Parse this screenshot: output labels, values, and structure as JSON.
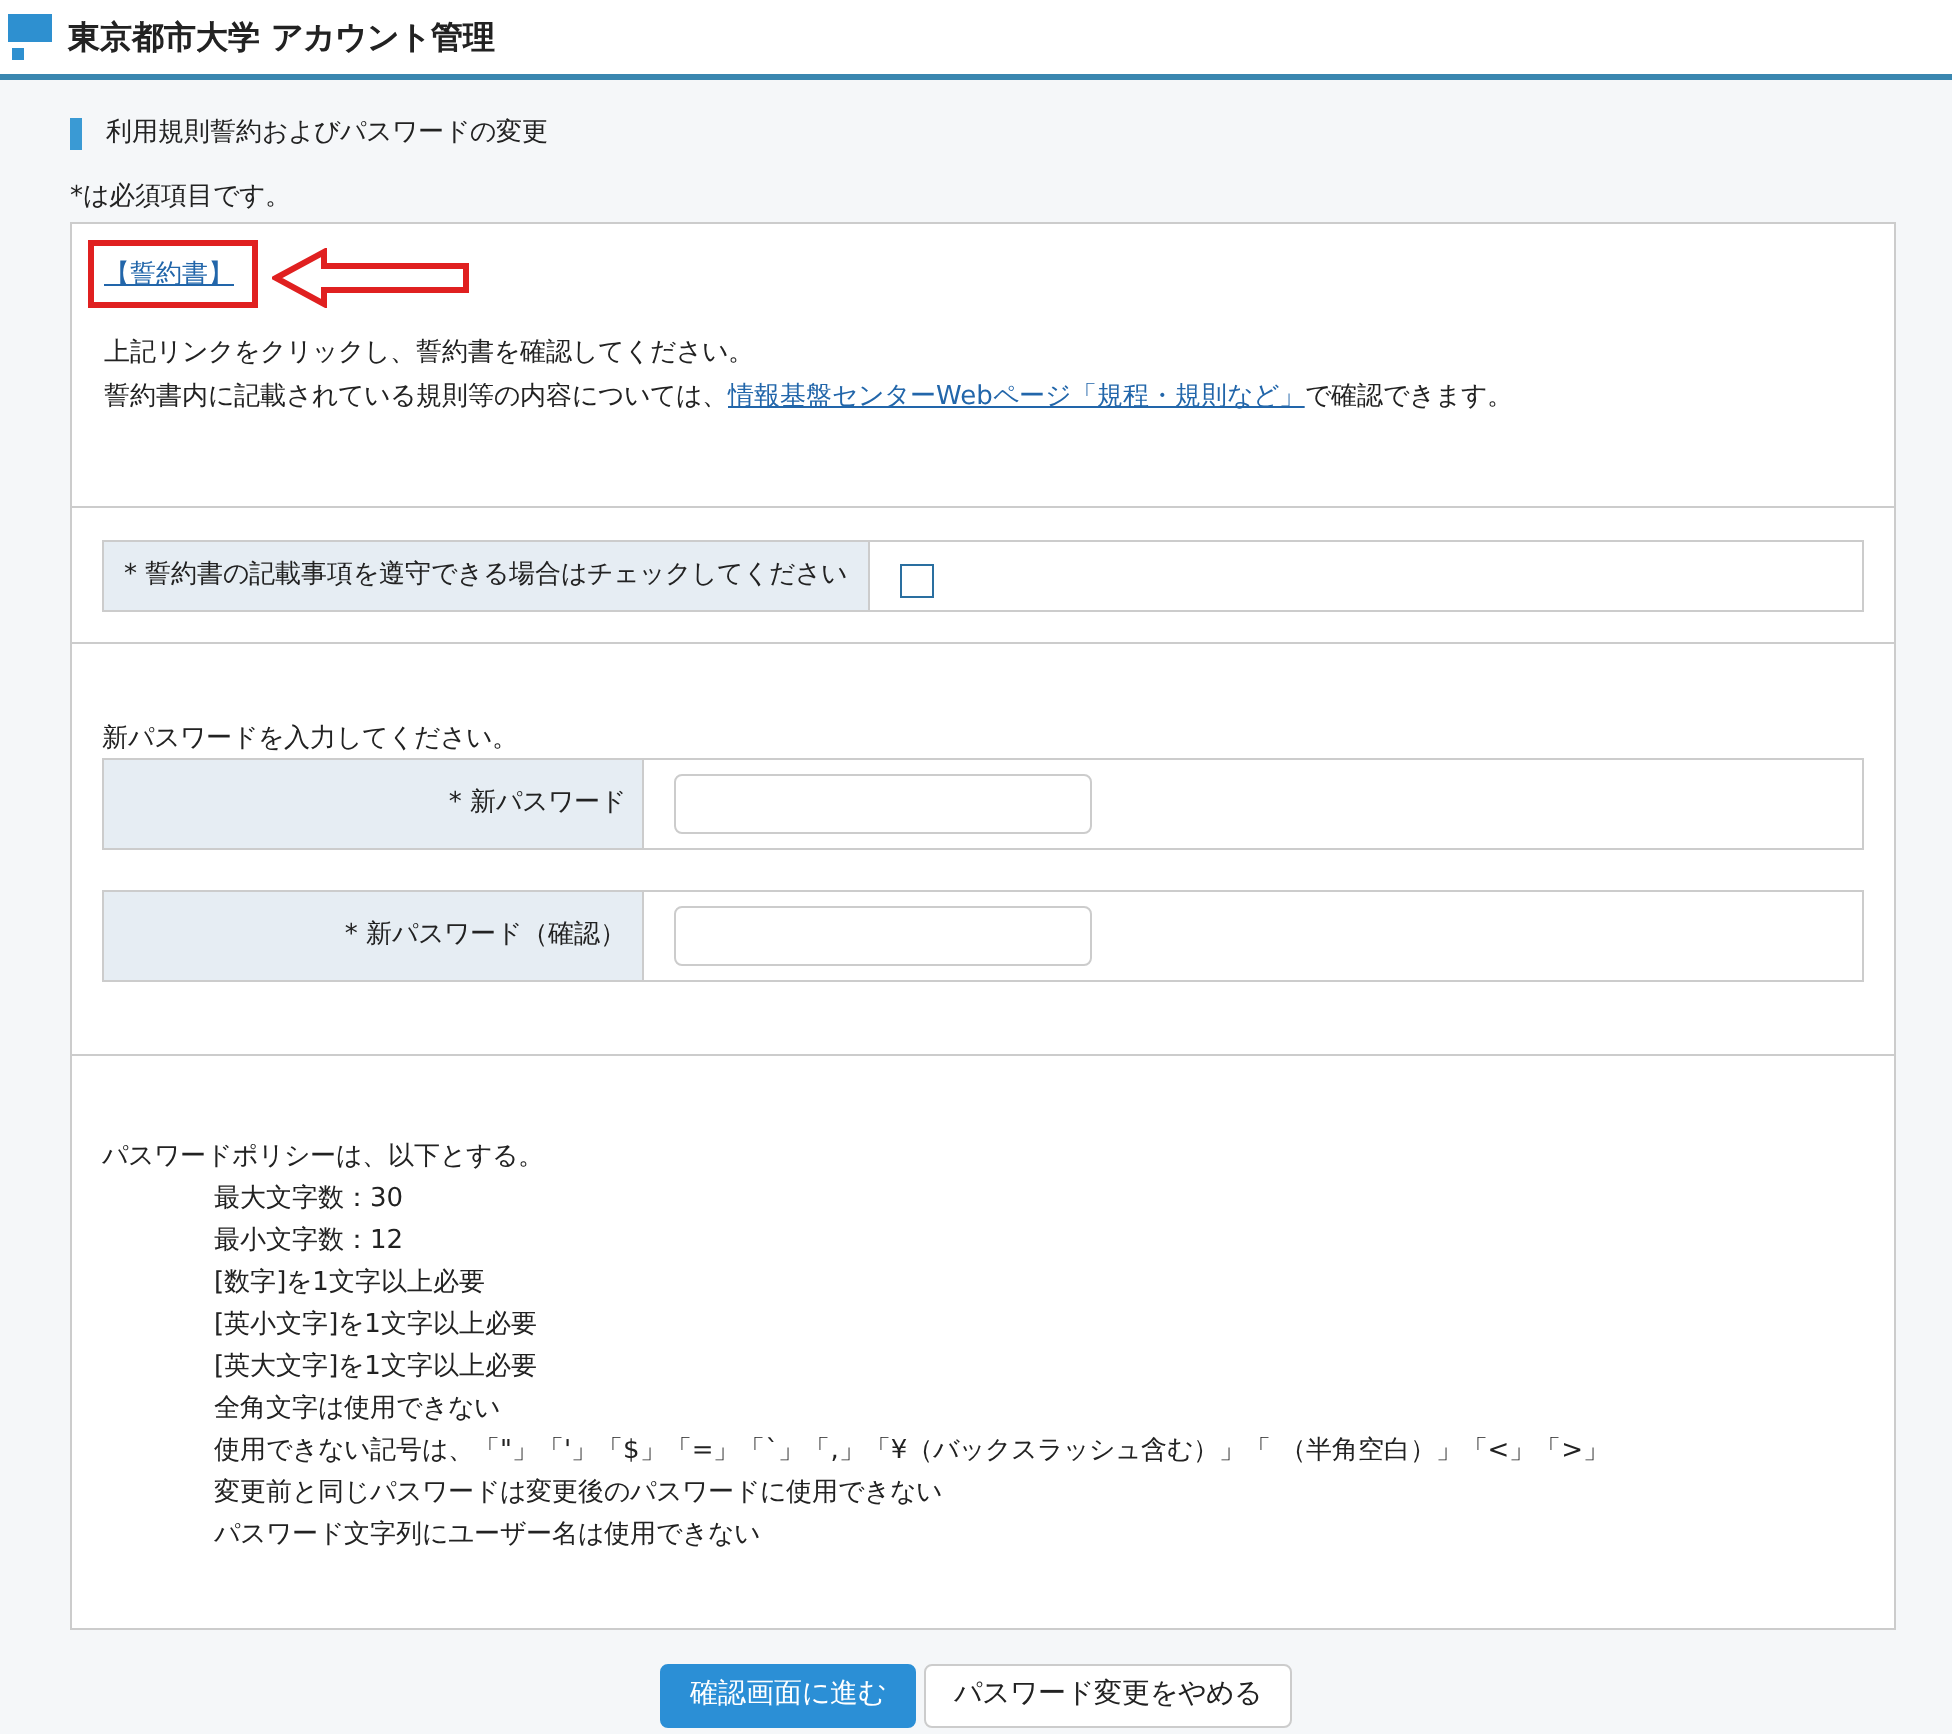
{
  "header": {
    "title": "東京都市大学 アカウント管理"
  },
  "section_title": "利用規則誓約およびパスワードの変更",
  "required_note": "*は必須項目です。",
  "pledge": {
    "link": "【誓約書】",
    "annotated": true,
    "line1": "上記リンクをクリックし、誓約書を確認してください。",
    "line2_before": "誓約書内に記載されている規則等の内容については、",
    "line2_link": "情報基盤センターWebページ「規程・規則など」",
    "line2_after": "で確認できます。"
  },
  "agree": {
    "label": "* 誓約書の記載事項を遵守できる場合はチェックしてください",
    "checked": false
  },
  "password": {
    "prompt": "新パスワードを入力してください。",
    "fields": [
      {
        "label": "* 新パスワード"
      },
      {
        "label": "* 新パスワード（確認）"
      }
    ]
  },
  "policy": {
    "heading": "パスワードポリシーは、以下とする。",
    "rules": [
      "最大文字数：30",
      "最小文字数：12",
      "[数字]を1文字以上必要",
      "[英小文字]を1文字以上必要",
      "[英大文字]を1文字以上必要",
      "全角文字は使用できない",
      "使用できない記号は、「\"」「'」「$」「=」「`」「,」「¥（バックスラッシュ含む）」「 （半角空白）」「<」「>」",
      "変更前と同じパスワードは変更後のパスワードに使用できない",
      "パスワード文字列にユーザー名は使用できない"
    ]
  },
  "buttons": [
    {
      "label": "確認画面に進む",
      "kind": "primary"
    },
    {
      "label": "パスワード変更をやめる",
      "kind": "secondary"
    }
  ]
}
